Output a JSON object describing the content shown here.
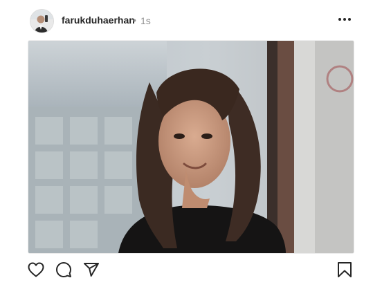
{
  "post": {
    "username": "farukduhaerhan",
    "separator": "•",
    "time": "1s"
  },
  "icons": {
    "more": "more-horizontal-icon",
    "like": "heart-icon",
    "comment": "comment-icon",
    "share": "send-icon",
    "save": "bookmark-icon"
  },
  "colors": {
    "text": "#262626",
    "muted": "#8e8e8e",
    "icon": "#262626"
  }
}
